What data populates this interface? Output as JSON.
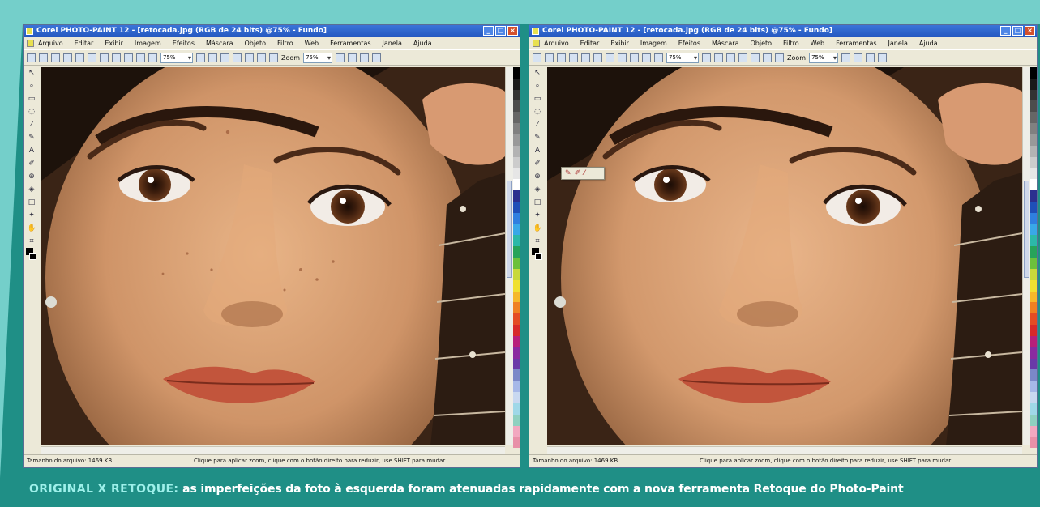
{
  "caption": {
    "lead": "ORIGINAL X RETOQUE:",
    "text": " as imperfeições da foto à esquerda foram atenuadas rapidamente com a nova ferramenta Retoque do Photo-Paint"
  },
  "windows": [
    {
      "title": "Corel PHOTO-PAINT 12 - [retocada.jpg (RGB de 24 bits) @75% - Fundo]",
      "menu": [
        "Arquivo",
        "Editar",
        "Exibir",
        "Imagem",
        "Efeitos",
        "Máscara",
        "Objeto",
        "Filtro",
        "Web",
        "Ferramentas",
        "Janela",
        "Ajuda"
      ],
      "zoom_value": "75%",
      "zoom_label": "Zoom",
      "status_left": "Tamanho do arquivo: 1469 KB",
      "status_hint": "Clique para aplicar zoom, clique com o botão direito para reduzir, use SHIFT para mudar..."
    },
    {
      "title": "Corel PHOTO-PAINT 12 - [retocada.jpg (RGB de 24 bits) @75% - Fundo]",
      "menu": [
        "Arquivo",
        "Editar",
        "Exibir",
        "Imagem",
        "Efeitos",
        "Máscara",
        "Objeto",
        "Filtro",
        "Web",
        "Ferramentas",
        "Janela",
        "Ajuda"
      ],
      "zoom_value": "75%",
      "zoom_label": "Zoom",
      "status_left": "Tamanho do arquivo: 1469 KB",
      "status_hint": "Clique para aplicar zoom, clique com o botão direito para reduzir, use SHIFT para mudar..."
    }
  ],
  "colors": {
    "background": "#1f8f86",
    "band": "#74cfca",
    "caption_lead": "#9ef0ea",
    "titlebar": "#2458c0"
  },
  "palette": [
    "#000000",
    "#1a1a1a",
    "#333333",
    "#4d4d4d",
    "#666666",
    "#808080",
    "#999999",
    "#b3b3b3",
    "#cccccc",
    "#e6e6e6",
    "#ffffff",
    "#2b2f8f",
    "#1f4fb8",
    "#2f7fe0",
    "#39a8e8",
    "#2cb8a8",
    "#27a35a",
    "#6cc03c",
    "#c8d83a",
    "#f0e030",
    "#f5b82a",
    "#ef8022",
    "#e44c24",
    "#d82a2a",
    "#b8207a",
    "#8a2aa0",
    "#6a3aa8",
    "#7b88c8",
    "#a6b8e8",
    "#c8d8f0",
    "#9fd8e8",
    "#8fd0c0",
    "#f2a8c0",
    "#e890a8"
  ]
}
